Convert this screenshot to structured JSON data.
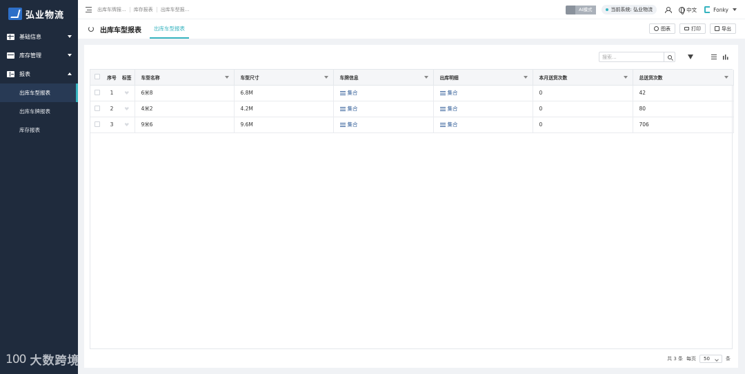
{
  "app": {
    "logo_text": "弘业物流"
  },
  "sidebar": {
    "groups": [
      {
        "label": "基础信息",
        "icon": "table-icon",
        "expanded": false
      },
      {
        "label": "库存管理",
        "icon": "inventory-icon",
        "expanded": false
      },
      {
        "label": "报表",
        "icon": "report-icon",
        "expanded": true
      }
    ],
    "sub_items": [
      {
        "label": "出库车型报表",
        "active": true
      },
      {
        "label": "出库车牌报表",
        "active": false
      },
      {
        "label": "库存报表",
        "active": false
      }
    ]
  },
  "topbar": {
    "breadcrumbs": [
      "出库车牌报...",
      "库存报表",
      "出库车型报..."
    ],
    "ai_mode": "AI模式",
    "current_system": "当前系统: 弘业物流",
    "language": "中文",
    "username": "Fonky"
  },
  "tabbar": {
    "page_title": "出库车型报表",
    "active_tab": "出库车型报表",
    "actions": {
      "chart": "图表",
      "print": "打印",
      "export": "导出"
    }
  },
  "toolbar": {
    "search_placeholder": "搜索..."
  },
  "table": {
    "headers": {
      "index": "序号",
      "tag": "标签",
      "model_name": "车型名称",
      "model_size": "车型尺寸",
      "plate_info": "车牌信息",
      "outbound_detail": "出库明细",
      "month_count": "本月送货次数",
      "total_count": "总送货次数"
    },
    "rows": [
      {
        "index": "1",
        "model_name": "6米8",
        "model_size": "6.8M",
        "plate_info": "集合",
        "outbound_detail": "集合",
        "month_count": "0",
        "total_count": "42"
      },
      {
        "index": "2",
        "model_name": "4米2",
        "model_size": "4.2M",
        "plate_info": "集合",
        "outbound_detail": "集合",
        "month_count": "0",
        "total_count": "80"
      },
      {
        "index": "3",
        "model_name": "9米6",
        "model_size": "9.6M",
        "plate_info": "集合",
        "outbound_detail": "集合",
        "month_count": "0",
        "total_count": "706"
      }
    ]
  },
  "pager": {
    "total": "共 3 条",
    "per_page_label": "每页",
    "page_size": "50",
    "unit": "条"
  },
  "watermark": {
    "logo": "100",
    "text": "大数跨境"
  },
  "colors": {
    "sidebar_bg": "#1f2b3d",
    "accent": "#35b3bf",
    "link": "#35609a"
  }
}
